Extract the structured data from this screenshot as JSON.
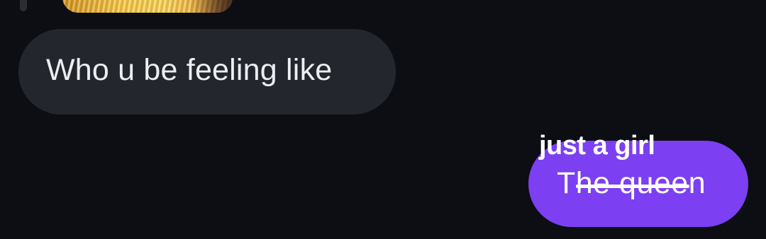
{
  "conversation": {
    "received_message": {
      "text": "Who u be feeling like"
    },
    "sent_message": {
      "text": "The queen",
      "overlay_text": "just a girl"
    }
  },
  "colors": {
    "background": "#0c0e13",
    "received_bubble": "#23262d",
    "sent_bubble": "#7c3ff2",
    "text": "#ffffff"
  }
}
